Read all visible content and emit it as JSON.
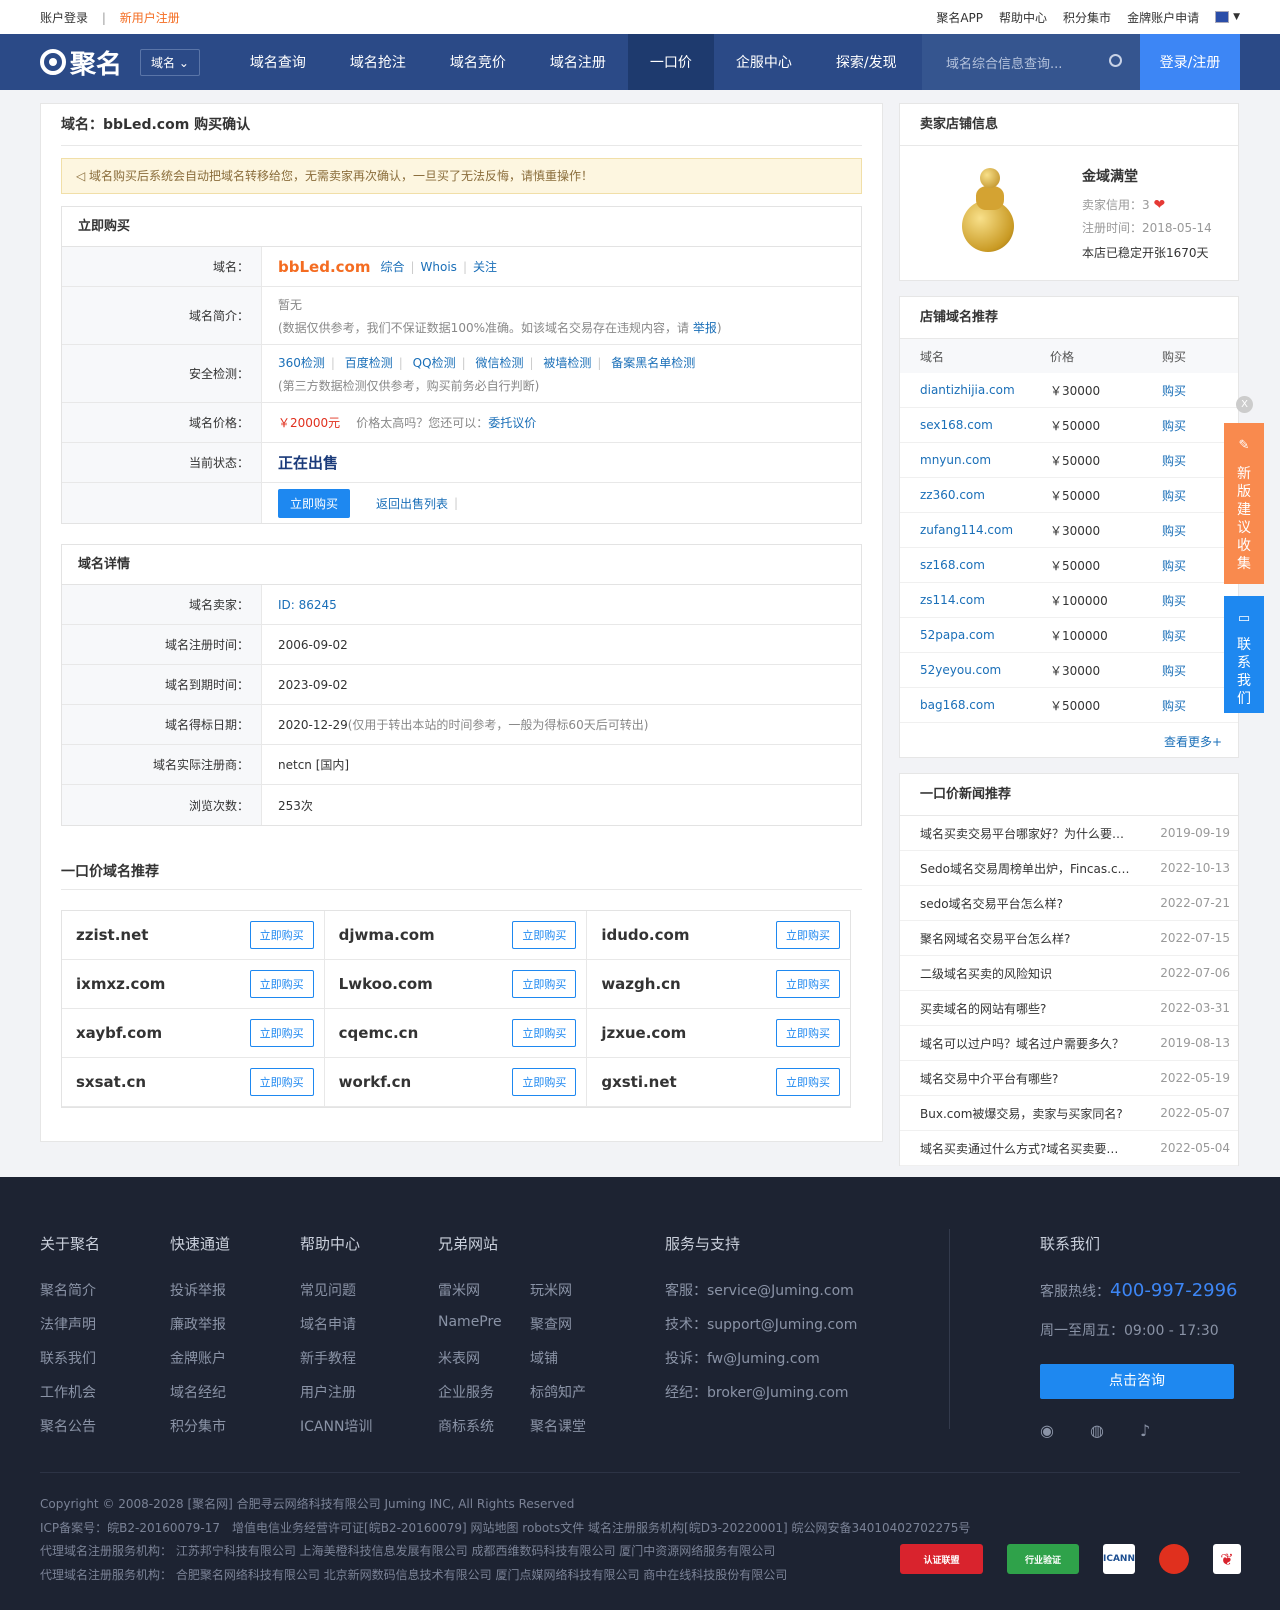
{
  "topbar": {
    "login": "账户登录",
    "sep": "|",
    "register": "新用户注册",
    "links": [
      "聚名APP",
      "帮助中心",
      "积分集市",
      "金牌账户申请"
    ]
  },
  "nav": {
    "logo": "聚名",
    "dropdown": "域名",
    "items": [
      "域名查询",
      "域名抢注",
      "域名竞价",
      "域名注册",
      "一口价",
      "企服中心",
      "探索/发现"
    ],
    "search_placeholder": "域名综合信息查询...",
    "login": "登录/注册"
  },
  "page": {
    "title": "域名：bbLed.com 购买确认",
    "notice": "◁ 域名购买后系统会自动把域名转移给您，无需卖家再次确认，一旦买了无法反悔，请慎重操作！"
  },
  "buy": {
    "header": "立即购买",
    "domain_label": "域名：",
    "domain": "bbLed.com",
    "links": [
      "综合",
      "Whois",
      "关注"
    ],
    "intro_label": "域名简介：",
    "intro": "暂无",
    "intro_note": "(数据仅供参考，我们不保证数据100%准确。如该域名交易存在违规内容，请 ",
    "report": "举报",
    "intro_end": ")",
    "sec_label": "安全检测：",
    "sec_links": [
      "360检测",
      "百度检测",
      "QQ检测",
      "微信检测",
      "被墙检测",
      "备案黑名单检测"
    ],
    "sec_note": "(第三方数据检测仅供参考，购买前务必自行判断)",
    "price_label": "域名价格：",
    "price": "￥20000元",
    "price_note": "价格太高吗？您还可以：",
    "bargain": "委托议价",
    "status_label": "当前状态：",
    "status": "正在出售",
    "buy_btn": "立即购买",
    "back": "返回出售列表"
  },
  "detail": {
    "header": "域名详情",
    "rows": [
      {
        "label": "域名卖家：",
        "value": "ID: 86245",
        "note": ""
      },
      {
        "label": "域名注册时间：",
        "value": "2006-09-02",
        "note": ""
      },
      {
        "label": "域名到期时间：",
        "value": "2023-09-02",
        "note": ""
      },
      {
        "label": "域名得标日期：",
        "value": "2020-12-29",
        "note": " (仅用于转出本站的时间参考，一般为得标60天后可转出)"
      },
      {
        "label": "域名实际注册商：",
        "value": "netcn [国内]",
        "note": ""
      },
      {
        "label": "浏览次数：",
        "value": "253次",
        "note": ""
      }
    ]
  },
  "rec": {
    "header": "一口价域名推荐",
    "btn": "立即购买",
    "domains": [
      "zzist.net",
      "djwma.com",
      "idudo.com",
      "ixmxz.com",
      "Lwkoo.com",
      "wazgh.cn",
      "xaybf.com",
      "cqemc.cn",
      "jzxue.com",
      "sxsat.cn",
      "workf.cn",
      "gxsti.net"
    ]
  },
  "shop": {
    "header": "卖家店铺信息",
    "name": "金域满堂",
    "credit": "卖家信用：3",
    "heart": "❤",
    "reg": "注册时间：2018-05-14",
    "stable": "本店已稳定开张1670天"
  },
  "shoprec": {
    "header": "店铺域名推荐",
    "cols": [
      "域名",
      "价格",
      "购买"
    ],
    "buy": "购买",
    "rows": [
      {
        "d": "diantizhijia.com",
        "p": "￥30000"
      },
      {
        "d": "sex168.com",
        "p": "￥50000"
      },
      {
        "d": "mnyun.com",
        "p": "￥50000"
      },
      {
        "d": "zz360.com",
        "p": "￥50000"
      },
      {
        "d": "zufang114.com",
        "p": "￥30000"
      },
      {
        "d": "sz168.com",
        "p": "￥50000"
      },
      {
        "d": "zs114.com",
        "p": "￥100000"
      },
      {
        "d": "52papa.com",
        "p": "￥100000"
      },
      {
        "d": "52yeyou.com",
        "p": "￥30000"
      },
      {
        "d": "bag168.com",
        "p": "￥50000"
      }
    ],
    "more": "查看更多+"
  },
  "news": {
    "header": "一口价新闻推荐",
    "items": [
      {
        "t": "域名买卖交易平台哪家好？为什么要选择聚名网",
        "d": "2019-09-19"
      },
      {
        "t": "Sedo域名交易周榜单出炉，Fincas.com位居榜首",
        "d": "2022-10-13"
      },
      {
        "t": "sedo域名交易平台怎么样?",
        "d": "2022-07-21"
      },
      {
        "t": "聚名网域名交易平台怎么样?",
        "d": "2022-07-15"
      },
      {
        "t": "二级域名买卖的风险知识",
        "d": "2022-07-06"
      },
      {
        "t": "买卖域名的网站有哪些?",
        "d": "2022-03-31"
      },
      {
        "t": "域名可以过户吗？域名过户需要多久？",
        "d": "2019-08-13"
      },
      {
        "t": "域名交易中介平台有哪些?",
        "d": "2022-05-19"
      },
      {
        "t": "Bux.com被爆交易，卖家与买家同名?",
        "d": "2022-05-07"
      },
      {
        "t": "域名买卖通过什么方式?域名买卖要注意什么",
        "d": "2022-05-04"
      }
    ]
  },
  "float": {
    "close": "X",
    "suggest": "新版建议收集",
    "contact": "联系我们",
    "suggest_color": "#f98a4e",
    "contact_color": "#1e88f0"
  },
  "footer": {
    "about": {
      "h": "关于聚名",
      "items": [
        "聚名简介",
        "法律声明",
        "联系我们",
        "工作机会",
        "聚名公告"
      ]
    },
    "quick": {
      "h": "快速通道",
      "items": [
        "投诉举报",
        "廉政举报",
        "金牌账户",
        "域名经纪",
        "积分集市"
      ]
    },
    "help": {
      "h": "帮助中心",
      "items": [
        "常见问题",
        "域名申请",
        "新手教程",
        "用户注册",
        "ICANN培训"
      ]
    },
    "sites": {
      "h": "兄弟网站",
      "items": [
        "雷米网",
        "玩米网",
        "NamePre",
        "聚查网",
        "米表网",
        "域铺",
        "企业服务",
        "标鸽知产",
        "商标系统",
        "聚名课堂"
      ]
    },
    "service": {
      "h": "服务与支持",
      "items": [
        "客服：service@Juming.com",
        "技术：support@Juming.com",
        "投诉：fw@Juming.com",
        "经纪：broker@Juming.com"
      ]
    },
    "contact": {
      "h": "联系我们",
      "hotline_label": "客服热线：",
      "hotline": "400-997-2996",
      "hours": "周一至周五：09:00 - 17:30",
      "consult": "点击咨询"
    },
    "copyright": "Copyright © 2008-2028 [聚名网] 合肥寻云网络科技有限公司 Juming INC, All Rights Reserved",
    "icp": "ICP备案号：皖B2-20160079-17　增值电信业务经营许可证[皖B2-20160079] 网站地图 robots文件 域名注册服务机构[皖D3-20220001] 皖公网安备34010402702275号",
    "agents1": "代理域名注册服务机构：  江苏邦宁科技有限公司 上海美橙科技信息发展有限公司 成都西维数码科技有限公司 厦门中资源网络服务有限公司",
    "agents2": "代理域名注册服务机构：  合肥聚名网络科技有限公司 北京新网数码信息技术有限公司 厦门点媒网络科技有限公司 商中在线科技股份有限公司",
    "badges": [
      "认证联盟",
      "行业验证",
      "ICANN",
      "",
      ""
    ]
  }
}
